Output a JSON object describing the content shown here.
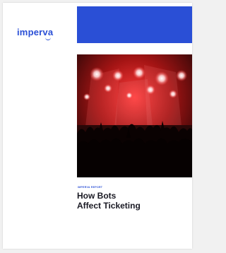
{
  "brand": {
    "logo_text": "imperva",
    "accent_color": "#2a4fd6"
  },
  "cover": {
    "eyebrow": "IMPERVA REPORT",
    "title_line1": "How Bots",
    "title_line2": "Affect Ticketing",
    "image_subject": "concert-crowd-photo"
  }
}
